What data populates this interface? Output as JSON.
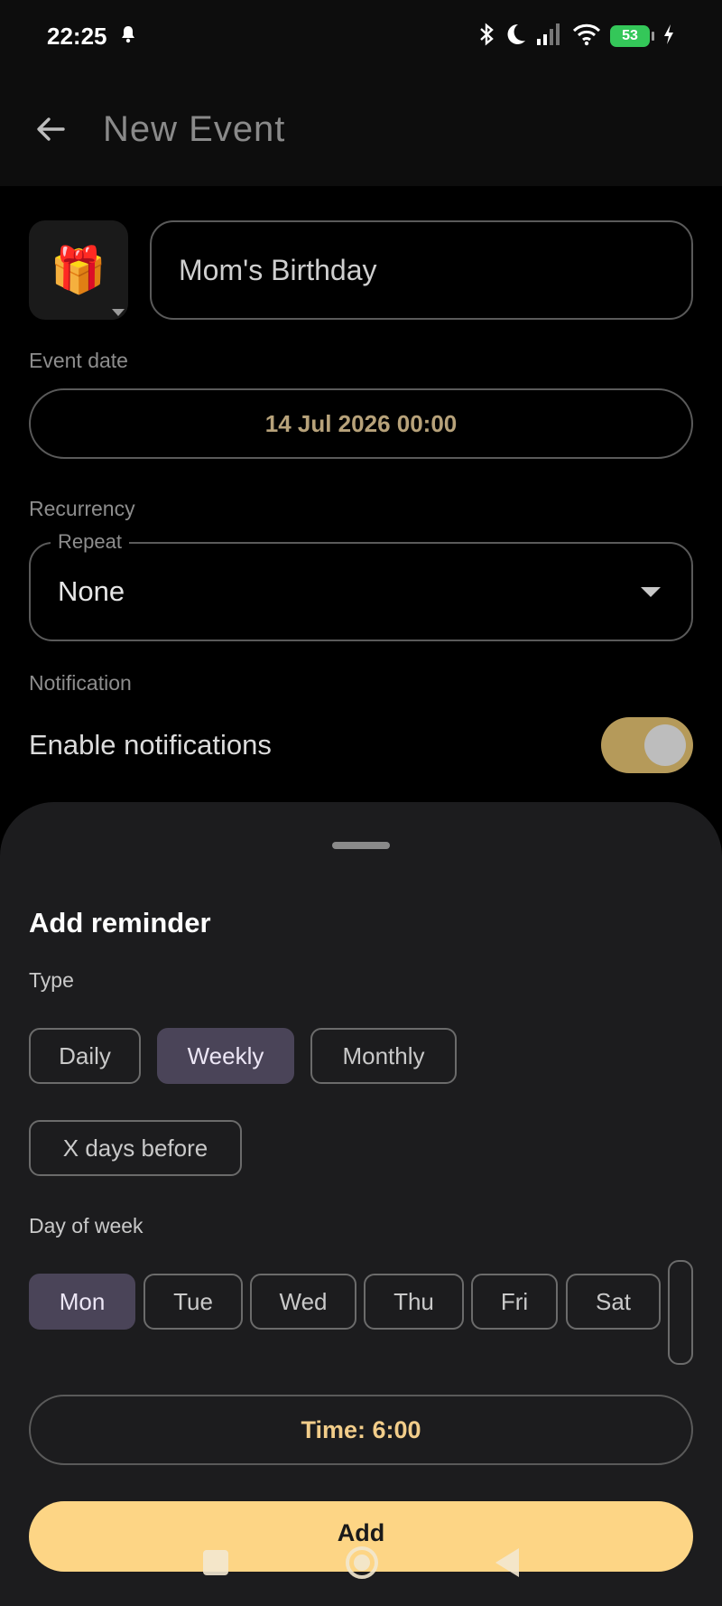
{
  "status_bar": {
    "time": "22:25",
    "battery": "53"
  },
  "app_bar": {
    "title": "New Event"
  },
  "form": {
    "icon": "🎁",
    "name_value": "Mom's Birthday",
    "event_date_label": "Event date",
    "event_date_value": "14 Jul 2026 00:00",
    "recurrency_label": "Recurrency",
    "repeat_legend": "Repeat",
    "repeat_value": "None",
    "notification_label": "Notification",
    "enable_notifications_label": "Enable notifications",
    "notifications_enabled": true
  },
  "sheet": {
    "title": "Add reminder",
    "type_label": "Type",
    "types": [
      "Daily",
      "Weekly",
      "Monthly",
      "X days before"
    ],
    "selected_type": "Weekly",
    "day_of_week_label": "Day of week",
    "days": [
      "Mon",
      "Tue",
      "Wed",
      "Thu",
      "Fri",
      "Sat"
    ],
    "selected_day": "Mon",
    "time_label": "Time: 6:00",
    "add_label": "Add"
  },
  "colors": {
    "accent": "#fdd585",
    "date_text": "#b7a27a",
    "toggle_on": "#b59a5a",
    "chip_selected": "#4a4458"
  }
}
